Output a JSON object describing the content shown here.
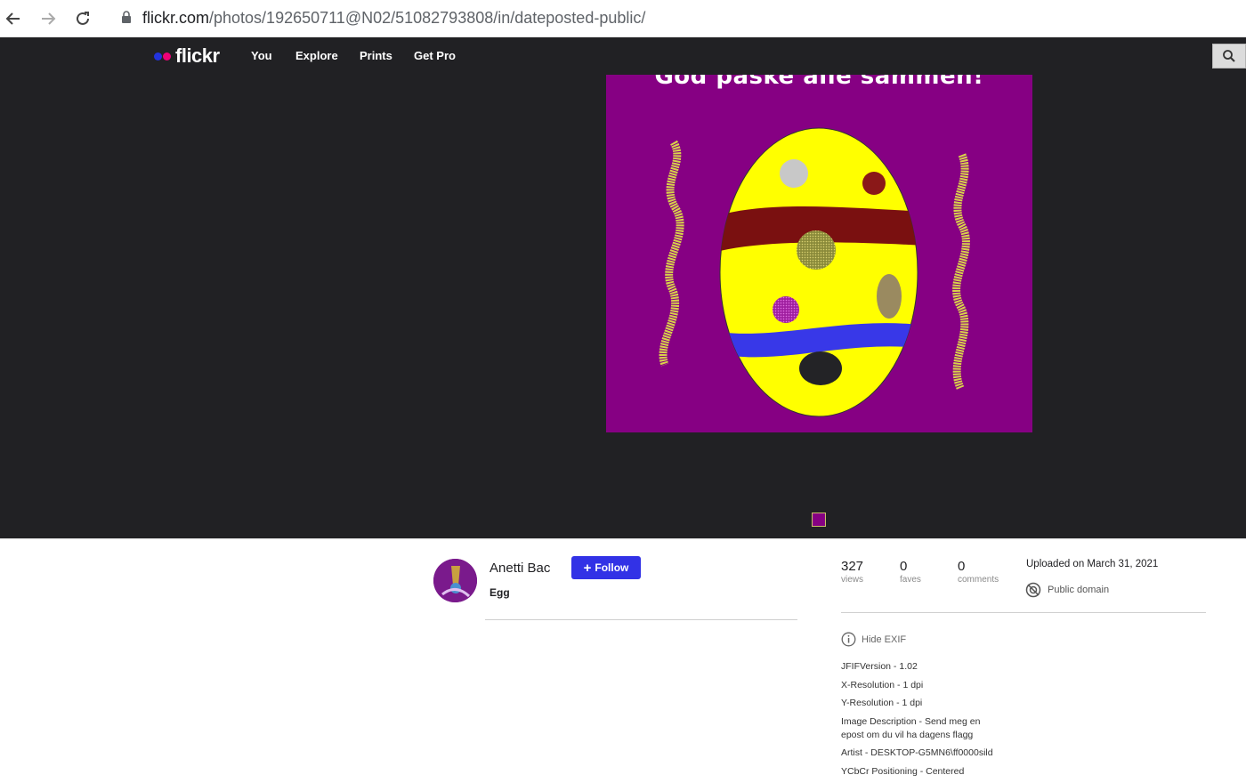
{
  "browser": {
    "url_host": "flickr.com",
    "url_path": "/photos/192650711@N02/51082793808/in/dateposted-public/"
  },
  "nav": {
    "logo_text": "flickr",
    "links": [
      "You",
      "Explore",
      "Prints",
      "Get Pro"
    ],
    "colors": {
      "dot_blue": "#2233dd",
      "dot_pink": "#ee0077",
      "bar": "#212124"
    }
  },
  "photo": {
    "caption": "God påske alle sammen!"
  },
  "owner": {
    "name": "Anetti Bac",
    "follow_label": "Follow",
    "photo_title": "Egg"
  },
  "stats": {
    "views": {
      "value": "327",
      "label": "views"
    },
    "faves": {
      "value": "0",
      "label": "faves"
    },
    "comments": {
      "value": "0",
      "label": "comments"
    }
  },
  "meta": {
    "uploaded": "Uploaded on March 31, 2021",
    "license": "Public domain"
  },
  "exif": {
    "toggle_label": "Hide EXIF",
    "rows": [
      "JFIFVersion - 1.02",
      "X-Resolution - 1 dpi",
      "Y-Resolution - 1 dpi",
      "Image Description - Send meg en epost om du vil ha dagens flagg",
      "Artist - DESKTOP-G5MN6\\ff0000sild",
      "YCbCr Positioning - Centered"
    ]
  }
}
